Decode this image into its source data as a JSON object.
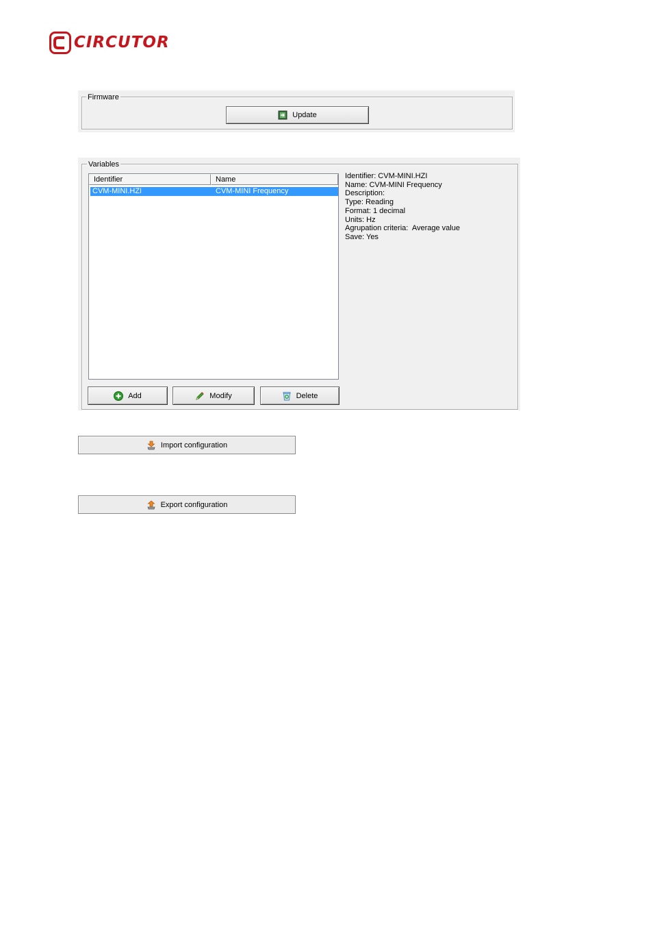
{
  "brand": {
    "name": "CIRCUTOR",
    "color": "#c4161c"
  },
  "firmware": {
    "legend": "Firmware",
    "update_label": "Update",
    "update_icon": "firmware-update-icon"
  },
  "variables": {
    "legend": "Variables",
    "columns": [
      "Identifier",
      "Name"
    ],
    "rows": [
      {
        "identifier": "CVM-MINI.HZI",
        "name": "CVM-MINI Frequency",
        "selected": true
      }
    ],
    "details": [
      "Identifier: CVM-MINI.HZI",
      "Name: CVM-MINI Frequency",
      "Description:",
      "Type: Reading",
      "Format: 1 decimal",
      "Units: Hz",
      "Agrupation criteria:  Average value",
      "Save: Yes"
    ],
    "buttons": {
      "add": "Add",
      "modify": "Modify",
      "delete": "Delete"
    },
    "selection_color": "#3399ff"
  },
  "import_label": "Import configuration",
  "export_label": "Export configuration"
}
